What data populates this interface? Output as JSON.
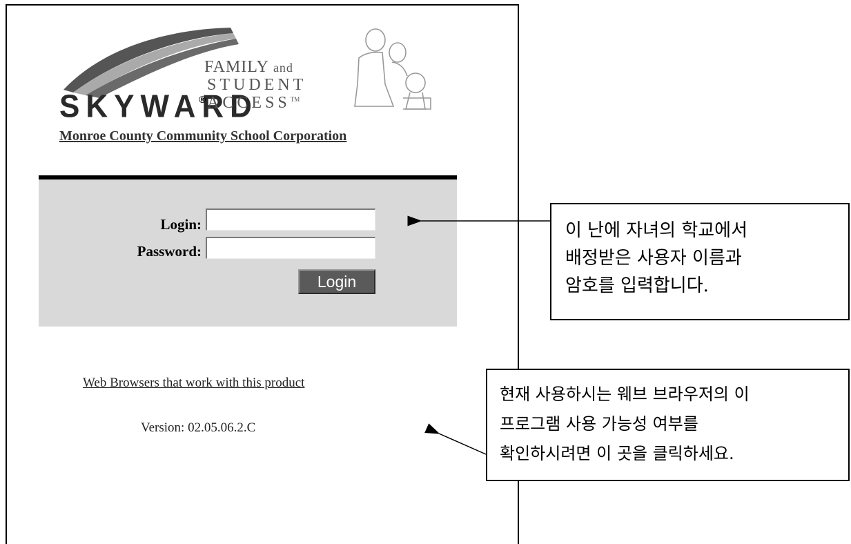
{
  "logo": {
    "brand": "SKYWARD",
    "registered": "®",
    "line1": "FAMILY",
    "line1_small": "and",
    "line2": "STUDENT",
    "line3": "ACCESS",
    "trademark": "TM"
  },
  "school_name": "Monroe County Community School Corporation",
  "login_form": {
    "login_label": "Login:",
    "login_value": "",
    "password_label": "Password:",
    "password_value": "",
    "submit_label": "Login"
  },
  "browsers_link": "Web Browsers that work with this product",
  "version": "Version: 02.05.06.2.C",
  "callouts": {
    "login_note": [
      "이 난에 자녀의 학교에서",
      "배정받은 사용자 이름과",
      "암호를 입력합니다."
    ],
    "browser_note": [
      "현재 사용하시는 웨브 브라우저의 이",
      "프로그램 사용 가능성 여부를",
      "확인하시려면 이 곳을 클릭하세요."
    ]
  },
  "colors": {
    "panel_bg": "#d9d9d9",
    "panel_bar": "#000000",
    "button_bg": "#5a5a5a"
  }
}
